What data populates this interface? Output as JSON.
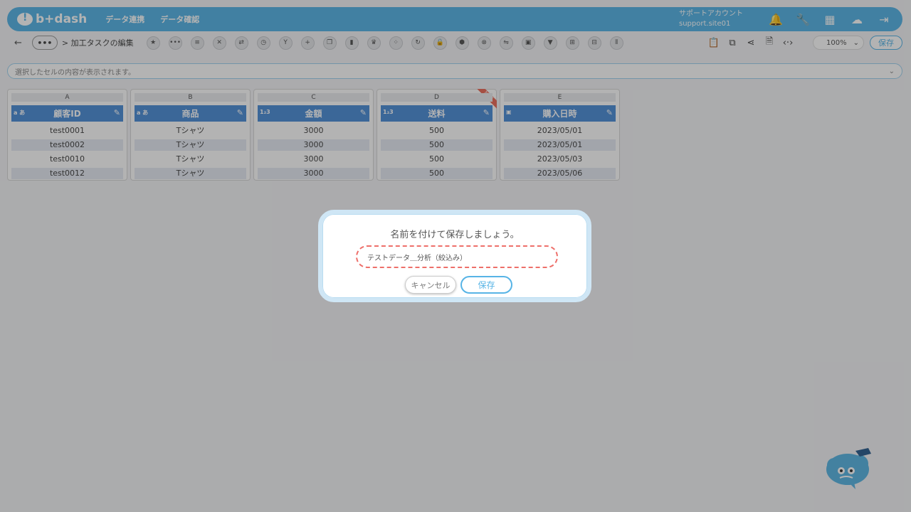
{
  "header": {
    "logo_text": "b+dash",
    "nav": [
      "データ連携",
      "データ確認"
    ],
    "account_name": "サポートアカウント",
    "account_site": "support.site01",
    "icons": [
      "bell-icon",
      "wrench-icon",
      "grid-icon",
      "mascot-icon",
      "logout-icon"
    ]
  },
  "toolbar": {
    "back": "←",
    "crumb_dots": "•••",
    "crumb": "> 加工タスクの編集",
    "zoom": "100%",
    "save_label": "保存"
  },
  "cellbar": {
    "placeholder": "選択したセルの内容が表示されます。"
  },
  "columns": [
    {
      "letter": "A",
      "name": "顧客ID",
      "type": "a あ",
      "cells": [
        "test0001",
        "test0002",
        "test0010",
        "test0012"
      ]
    },
    {
      "letter": "B",
      "name": "商品",
      "type": "a あ",
      "cells": [
        "Tシャツ",
        "Tシャツ",
        "Tシャツ",
        "Tシャツ"
      ]
    },
    {
      "letter": "C",
      "name": "金額",
      "type": "1₂3",
      "cells": [
        "3000",
        "3000",
        "3000",
        "3000"
      ]
    },
    {
      "letter": "D",
      "name": "送料",
      "type": "1₂3",
      "cells": [
        "500",
        "500",
        "500",
        "500"
      ],
      "badge": "NEW"
    },
    {
      "letter": "E",
      "name": "購入日時",
      "type": "▣",
      "cells": [
        "2023/05/01",
        "2023/05/01",
        "2023/05/03",
        "2023/05/06"
      ]
    }
  ],
  "modal": {
    "title": "名前を付けて保存しましょう。",
    "input_value": "テストデータ＿分析（絞込み）",
    "cancel_label": "キャンセル",
    "save_label": "保存"
  },
  "colors": {
    "brand": "#57b4e6",
    "column_header": "#4f8fd8",
    "highlight_dashed": "#ee6f6a"
  }
}
